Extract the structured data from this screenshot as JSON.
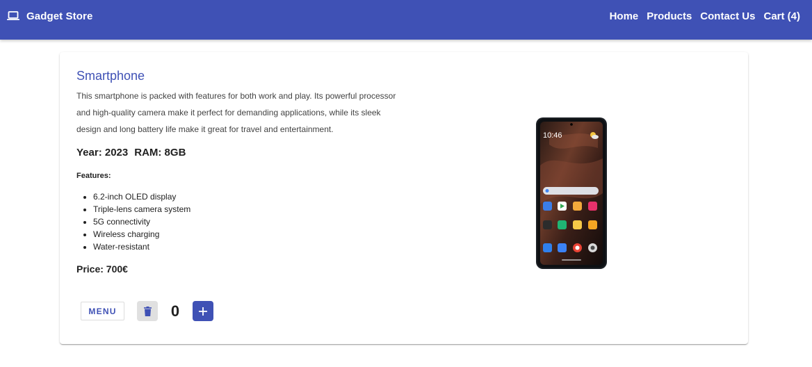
{
  "app": {
    "title": "Gadget Store",
    "icon": "laptop-icon"
  },
  "nav": {
    "items": [
      {
        "label": "Home"
      },
      {
        "label": "Products"
      },
      {
        "label": "Contact Us"
      },
      {
        "label": "Cart (4)"
      }
    ]
  },
  "product": {
    "title": "Smartphone",
    "description": "This smartphone is packed with features for both work and play. Its powerful processor and high-quality camera make it perfect for demanding applications, while its sleek design and long battery life make it great for travel and entertainment.",
    "year_label": "Year: 2023",
    "ram_label": "RAM: 8GB",
    "features_heading": "Features:",
    "features": [
      "6.2-inch OLED display",
      "Triple-lens camera system",
      "5G connectivity",
      "Wireless charging",
      "Water-resistant"
    ],
    "price_label": "Price: 700€",
    "image_clock": "10:46"
  },
  "actions": {
    "menu_label": "MENU",
    "delete_icon": "trash-icon",
    "quantity": "0",
    "add_icon": "plus-icon"
  },
  "colors": {
    "primary": "#3f51b5",
    "delete_bg": "#e0e0e0",
    "appbar_text": "#ffffff"
  }
}
